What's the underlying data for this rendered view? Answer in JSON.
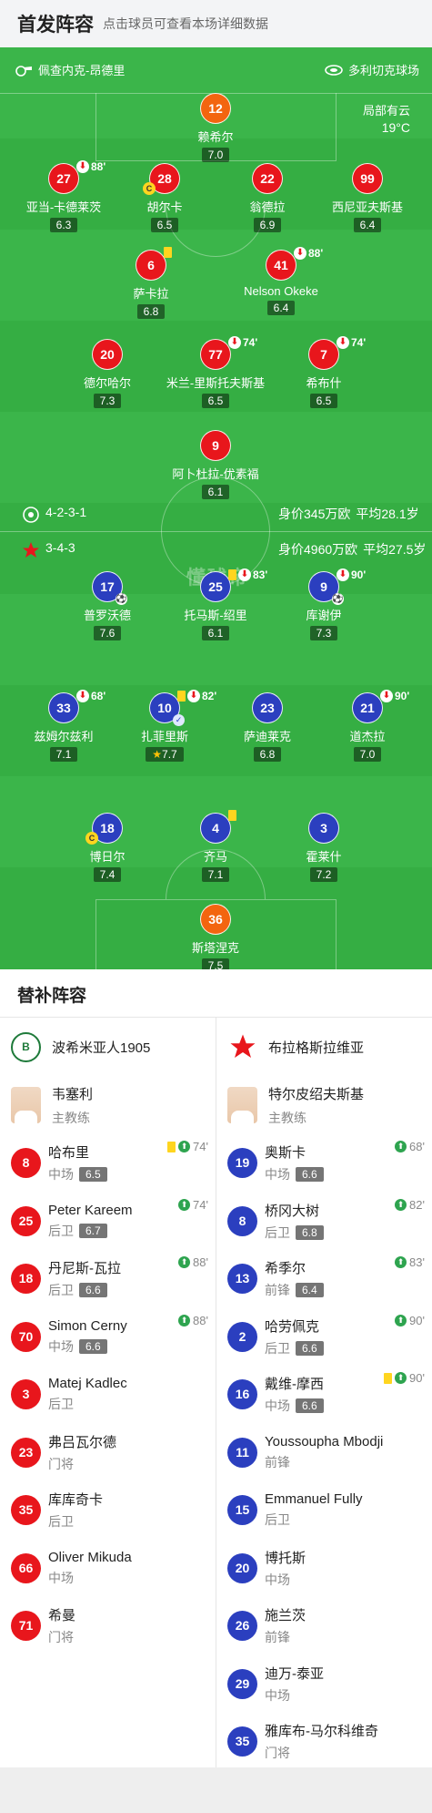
{
  "header": {
    "title": "首发阵容",
    "subtitle": "点击球员可查看本场详细数据"
  },
  "pitch_info": {
    "referee": "佩查内克-昂德里",
    "stadium": "多利切克球场",
    "weather": "局部有云",
    "temperature": "19°C"
  },
  "home_summary": {
    "formation": "4-2-3-1",
    "value": "身价345万欧",
    "avg_age": "平均28.1岁"
  },
  "away_summary": {
    "formation": "3-4-3",
    "value": "身价4960万欧",
    "avg_age": "平均27.5岁"
  },
  "watermark": "懂球帝",
  "home_players": [
    {
      "num": "12",
      "name": "赖希尔",
      "rating": "7.0",
      "event": ""
    },
    {
      "num": "27",
      "name": "亚当-卡德莱茨",
      "rating": "6.3",
      "event": "88'"
    },
    {
      "num": "28",
      "name": "胡尔卡",
      "rating": "6.5",
      "event": ""
    },
    {
      "num": "22",
      "name": "翁德拉",
      "rating": "6.9",
      "event": ""
    },
    {
      "num": "99",
      "name": "西尼亚夫斯基",
      "rating": "6.4",
      "event": ""
    },
    {
      "num": "6",
      "name": "萨卡拉",
      "rating": "6.8",
      "event": ""
    },
    {
      "num": "41",
      "name": "Nelson Okeke",
      "rating": "6.4",
      "event": "88'"
    },
    {
      "num": "20",
      "name": "德尔哈尔",
      "rating": "7.3",
      "event": ""
    },
    {
      "num": "77",
      "name": "米兰-里斯托夫斯基",
      "rating": "6.5",
      "event": "74'"
    },
    {
      "num": "7",
      "name": "希布什",
      "rating": "6.5",
      "event": "74'"
    },
    {
      "num": "9",
      "name": "阿卜杜拉-优素福",
      "rating": "6.1",
      "event": ""
    }
  ],
  "away_players": [
    {
      "num": "17",
      "name": "普罗沃德",
      "rating": "7.6",
      "event": ""
    },
    {
      "num": "25",
      "name": "托马斯-绍里",
      "rating": "6.1",
      "event": "83'"
    },
    {
      "num": "9",
      "name": "库谢伊",
      "rating": "7.3",
      "event": "90'"
    },
    {
      "num": "33",
      "name": "兹姆尔兹利",
      "rating": "7.1",
      "event": "68'"
    },
    {
      "num": "10",
      "name": "扎菲里斯",
      "rating": "7.7",
      "event": "82'"
    },
    {
      "num": "23",
      "name": "萨迪莱克",
      "rating": "6.8",
      "event": ""
    },
    {
      "num": "21",
      "name": "道杰拉",
      "rating": "7.0",
      "event": "90'"
    },
    {
      "num": "18",
      "name": "博日尔",
      "rating": "7.4",
      "event": ""
    },
    {
      "num": "4",
      "name": "齐马",
      "rating": "7.1",
      "event": ""
    },
    {
      "num": "3",
      "name": "霍莱什",
      "rating": "7.2",
      "event": ""
    },
    {
      "num": "36",
      "name": "斯塔涅克",
      "rating": "7.5",
      "event": ""
    }
  ],
  "subs_title": "替补阵容",
  "left_team": {
    "name": "波希米亚人1905",
    "crest_text": "B",
    "coach": {
      "name": "韦塞利",
      "role": "主教练"
    },
    "subs": [
      {
        "num": "8",
        "name": "哈布里",
        "pos": "中场",
        "rating": "6.5",
        "event": "74'"
      },
      {
        "num": "25",
        "name": "Peter Kareem",
        "pos": "后卫",
        "rating": "6.7",
        "event": "74'"
      },
      {
        "num": "18",
        "name": "丹尼斯-瓦拉",
        "pos": "后卫",
        "rating": "6.6",
        "event": "88'"
      },
      {
        "num": "70",
        "name": "Simon Cerny",
        "pos": "中场",
        "rating": "6.6",
        "event": "88'"
      },
      {
        "num": "3",
        "name": "Matej Kadlec",
        "pos": "后卫",
        "rating": "",
        "event": ""
      },
      {
        "num": "23",
        "name": "弗吕瓦尔德",
        "pos": "门将",
        "rating": "",
        "event": ""
      },
      {
        "num": "35",
        "name": "库库奇卡",
        "pos": "后卫",
        "rating": "",
        "event": ""
      },
      {
        "num": "66",
        "name": "Oliver Mikuda",
        "pos": "中场",
        "rating": "",
        "event": ""
      },
      {
        "num": "71",
        "name": "希曼",
        "pos": "门将",
        "rating": "",
        "event": ""
      }
    ]
  },
  "right_team": {
    "name": "布拉格斯拉维亚",
    "coach": {
      "name": "特尔皮绍夫斯基",
      "role": "主教练"
    },
    "subs": [
      {
        "num": "19",
        "name": "奥斯卡",
        "pos": "中场",
        "rating": "6.6",
        "event": "68'"
      },
      {
        "num": "8",
        "name": "桥冈大树",
        "pos": "后卫",
        "rating": "6.8",
        "event": "82'"
      },
      {
        "num": "13",
        "name": "希季尔",
        "pos": "前锋",
        "rating": "6.4",
        "event": "83'"
      },
      {
        "num": "2",
        "name": "哈劳佩克",
        "pos": "后卫",
        "rating": "6.6",
        "event": "90'"
      },
      {
        "num": "16",
        "name": "戴维-摩西",
        "pos": "中场",
        "rating": "6.6",
        "event": "90'"
      },
      {
        "num": "11",
        "name": "Youssoupha Mbodji",
        "pos": "前锋",
        "rating": "",
        "event": ""
      },
      {
        "num": "15",
        "name": "Emmanuel Fully",
        "pos": "后卫",
        "rating": "",
        "event": ""
      },
      {
        "num": "20",
        "name": "博托斯",
        "pos": "中场",
        "rating": "",
        "event": ""
      },
      {
        "num": "26",
        "name": "施兰茨",
        "pos": "前锋",
        "rating": "",
        "event": ""
      },
      {
        "num": "29",
        "name": "迪万-泰亚",
        "pos": "中场",
        "rating": "",
        "event": ""
      },
      {
        "num": "35",
        "name": "雅库布-马尔科维奇",
        "pos": "门将",
        "rating": "",
        "event": ""
      }
    ]
  }
}
